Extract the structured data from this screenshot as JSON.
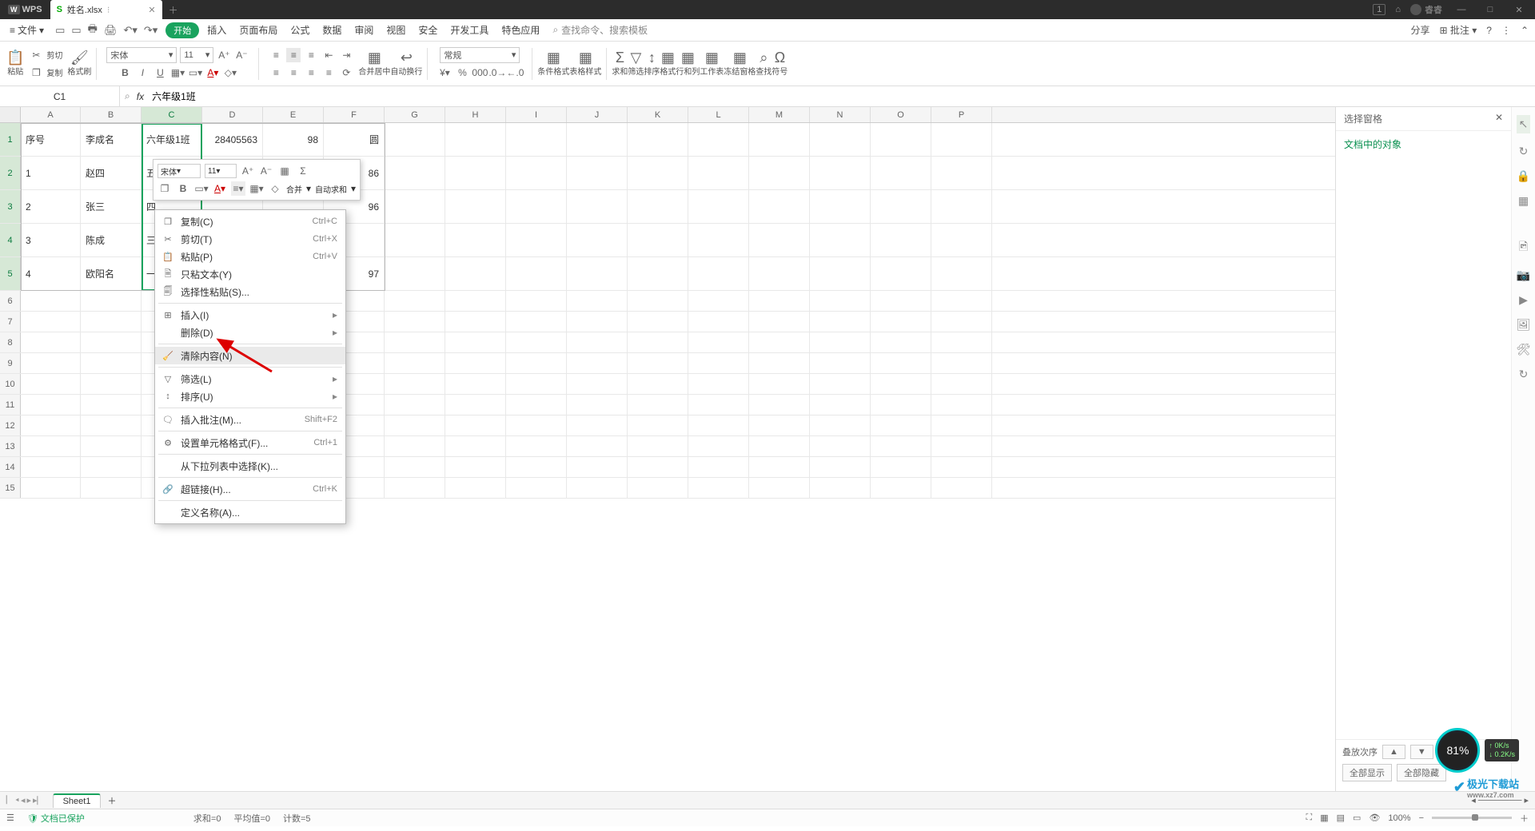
{
  "titlebar": {
    "app": "WPS",
    "file": "姓名.xlsx",
    "user": "睿睿",
    "badge": "1"
  },
  "menubar": {
    "file": "文件",
    "tabs": {
      "start": "开始",
      "insert": "插入",
      "layout": "页面布局",
      "formula": "公式",
      "data": "数据",
      "review": "审阅",
      "view": "视图",
      "security": "安全",
      "dev": "开发工具",
      "special": "特色应用"
    },
    "search_placeholder": "查找命令、搜索模板",
    "share": "分享",
    "comment": "批注"
  },
  "ribbon": {
    "paste": "粘贴",
    "cut": "剪切",
    "copy": "复制",
    "fmtpaint": "格式刷",
    "font": "宋体",
    "fontsize": "11",
    "merge": "合并居中",
    "wrap": "自动换行",
    "numfmt": "常规",
    "condfmt": "条件格式",
    "tblfmt": "表格样式",
    "sum": "求和",
    "filter": "筛选",
    "sort": "排序",
    "format": "格式",
    "rowcol": "行和列",
    "sheet": "工作表",
    "freeze": "冻结窗格",
    "find": "查找",
    "symbol": "符号"
  },
  "formula": {
    "cellref": "C1",
    "content": "六年级1班"
  },
  "columns": [
    "A",
    "B",
    "C",
    "D",
    "E",
    "F",
    "G",
    "H",
    "I",
    "J",
    "K",
    "L",
    "M",
    "N",
    "O",
    "P"
  ],
  "rowheaders": [
    "1",
    "2",
    "3",
    "4",
    "5",
    "6",
    "7",
    "8",
    "9",
    "10",
    "11",
    "12",
    "13",
    "14",
    "15"
  ],
  "sheetdata": {
    "r1": {
      "A": "序号",
      "B": "李成名",
      "C": "六年级1班",
      "D": "28405563",
      "E": "98",
      "F": "圆"
    },
    "r2": {
      "A": "1",
      "B": "赵四",
      "C": "五",
      "F": "86"
    },
    "r3": {
      "A": "2",
      "B": "张三",
      "C": "四",
      "F": "96"
    },
    "r4": {
      "A": "3",
      "B": "陈成",
      "C": "三"
    },
    "r5": {
      "A": "4",
      "B": "欧阳名",
      "C": "一",
      "F": "97"
    }
  },
  "minitoolbar": {
    "font": "宋体",
    "size": "11",
    "merge": "合并",
    "autosum": "自动求和"
  },
  "contextmenu": {
    "copy": "复制(C)",
    "copy_sc": "Ctrl+C",
    "cut": "剪切(T)",
    "cut_sc": "Ctrl+X",
    "paste": "粘贴(P)",
    "paste_sc": "Ctrl+V",
    "paste_text": "只粘文本(Y)",
    "paste_special": "选择性粘贴(S)...",
    "insert": "插入(I)",
    "delete": "删除(D)",
    "clear": "清除内容(N)",
    "filter": "筛选(L)",
    "sort": "排序(U)",
    "comment": "插入批注(M)...",
    "comment_sc": "Shift+F2",
    "fmtcell": "设置单元格格式(F)...",
    "fmtcell_sc": "Ctrl+1",
    "dropdown": "从下拉列表中选择(K)...",
    "hyperlink": "超链接(H)...",
    "hyperlink_sc": "Ctrl+K",
    "defname": "定义名称(A)..."
  },
  "rightpanel": {
    "title": "选择窗格",
    "sub": "文档中的对象",
    "stack": "叠放次序",
    "showall": "全部显示",
    "hideall": "全部隐藏"
  },
  "sheettab": "Sheet1",
  "status": {
    "protect": "文档已保护",
    "sum": "求和=0",
    "avg": "平均值=0",
    "count": "计数=5",
    "zoom": "100%"
  },
  "gauge": "81%",
  "net": {
    "up": "0K/s",
    "down": "0.2K/s"
  },
  "brand": {
    "name": "极光下载站",
    "url": "www.xz7.com"
  }
}
